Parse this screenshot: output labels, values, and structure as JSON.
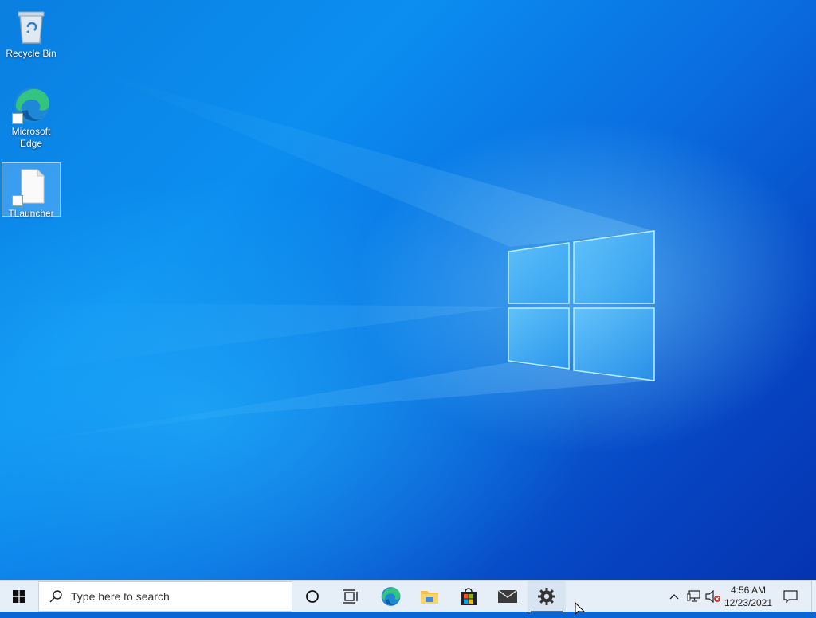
{
  "desktop": {
    "icons": [
      {
        "label": "Recycle Bin",
        "icon": "recycle-bin-icon"
      },
      {
        "label": "Microsoft Edge",
        "label_line1": "Microsoft",
        "label_line2": "Edge",
        "icon": "edge-icon"
      },
      {
        "label": "TLauncher",
        "icon": "file-icon",
        "selected": true
      }
    ]
  },
  "taskbar": {
    "start": "windows-start-icon",
    "search_placeholder": "Type here to search",
    "apps": [
      {
        "name": "cortana",
        "icon": "circle-icon"
      },
      {
        "name": "task-view",
        "icon": "task-view-icon"
      },
      {
        "name": "edge",
        "icon": "edge-icon"
      },
      {
        "name": "file-explorer",
        "icon": "folder-icon"
      },
      {
        "name": "store",
        "icon": "store-icon"
      },
      {
        "name": "mail",
        "icon": "mail-icon"
      },
      {
        "name": "settings",
        "icon": "gear-icon",
        "active": true
      }
    ],
    "tray": {
      "time": "4:56 AM",
      "date": "12/23/2021"
    }
  },
  "colors": {
    "accent": "#2a78d4",
    "wallpaper": "#0a7fe0",
    "taskbar": "#e6eef8"
  }
}
